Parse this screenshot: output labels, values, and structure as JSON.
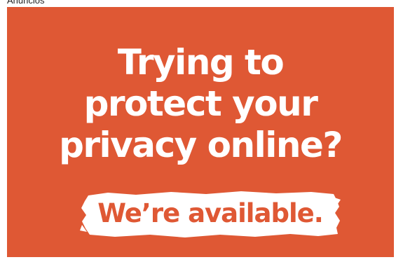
{
  "ad_label": "Anuncios",
  "banner": {
    "headline_lines": [
      "Trying to",
      "protect your",
      "privacy online?"
    ],
    "cta": "We’re available.",
    "colors": {
      "background": "#df5834",
      "headline": "#ffffff",
      "cta_background": "#ffffff",
      "cta_text": "#df5834"
    }
  }
}
